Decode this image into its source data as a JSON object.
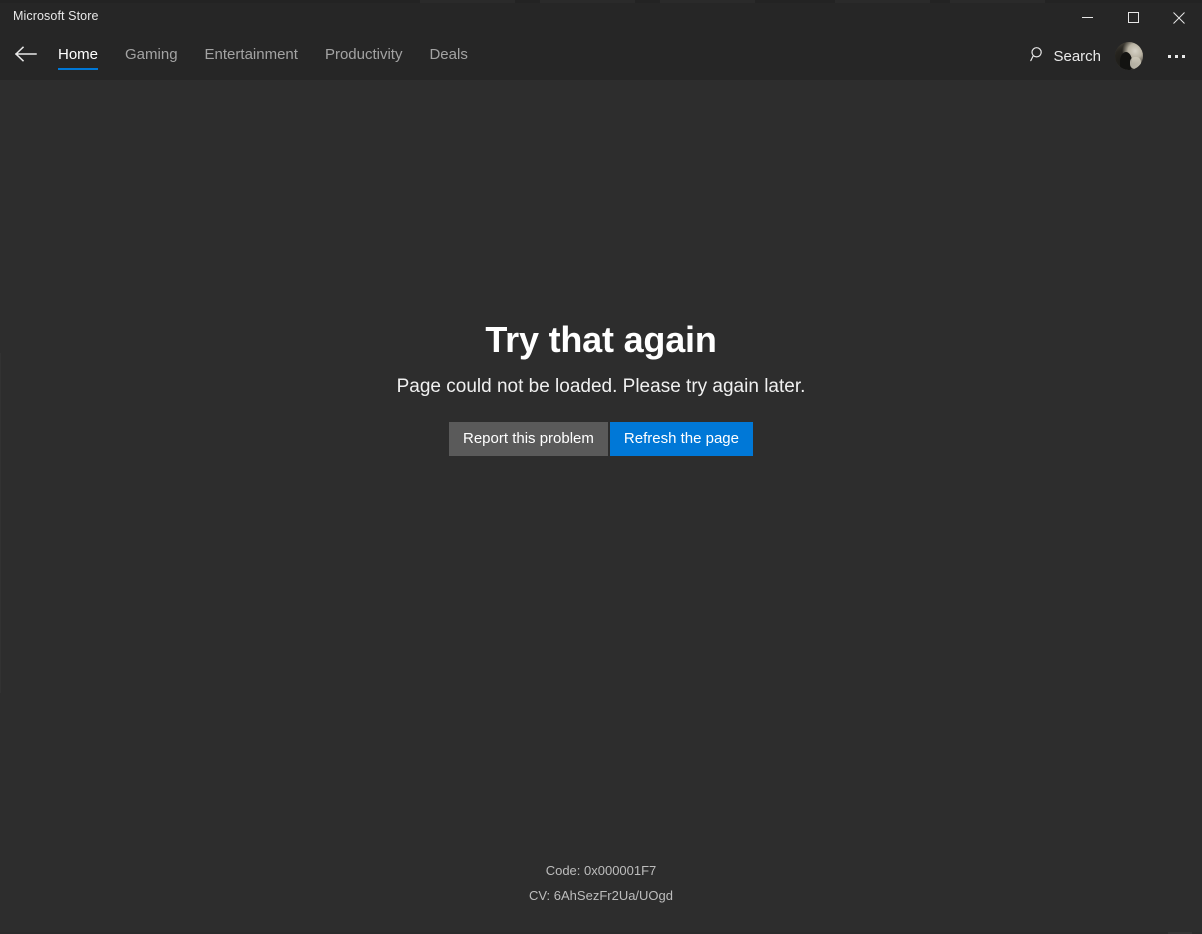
{
  "window": {
    "title": "Microsoft Store",
    "controls": [
      {
        "name": "minimize",
        "label": "Minimize"
      },
      {
        "name": "maximize",
        "label": "Maximize"
      },
      {
        "name": "close",
        "label": "Close"
      }
    ]
  },
  "nav": {
    "back_label": "Back",
    "tabs": [
      {
        "label": "Home",
        "active": true
      },
      {
        "label": "Gaming",
        "active": false
      },
      {
        "label": "Entertainment",
        "active": false
      },
      {
        "label": "Productivity",
        "active": false
      },
      {
        "label": "Deals",
        "active": false
      }
    ],
    "search_label": "Search",
    "search_icon": "search-icon",
    "account_icon": "account-avatar",
    "more_label": "See more",
    "more_icon": "ellipsis-icon"
  },
  "error": {
    "title": "Try that again",
    "message": "Page could not be loaded. Please try again later.",
    "report_button": "Report this problem",
    "refresh_button": "Refresh the page",
    "code_line": "Code: 0x000001F7",
    "cv_line": "CV: 6AhSezFr2Ua/UOgd"
  },
  "colors": {
    "accent": "#0078d7",
    "titlebar_bg": "#262626",
    "content_bg": "#2d2d2d",
    "secondary_button_bg": "#5a5a5a",
    "text_primary": "#ffffff",
    "text_muted": "#a3a3a3"
  }
}
